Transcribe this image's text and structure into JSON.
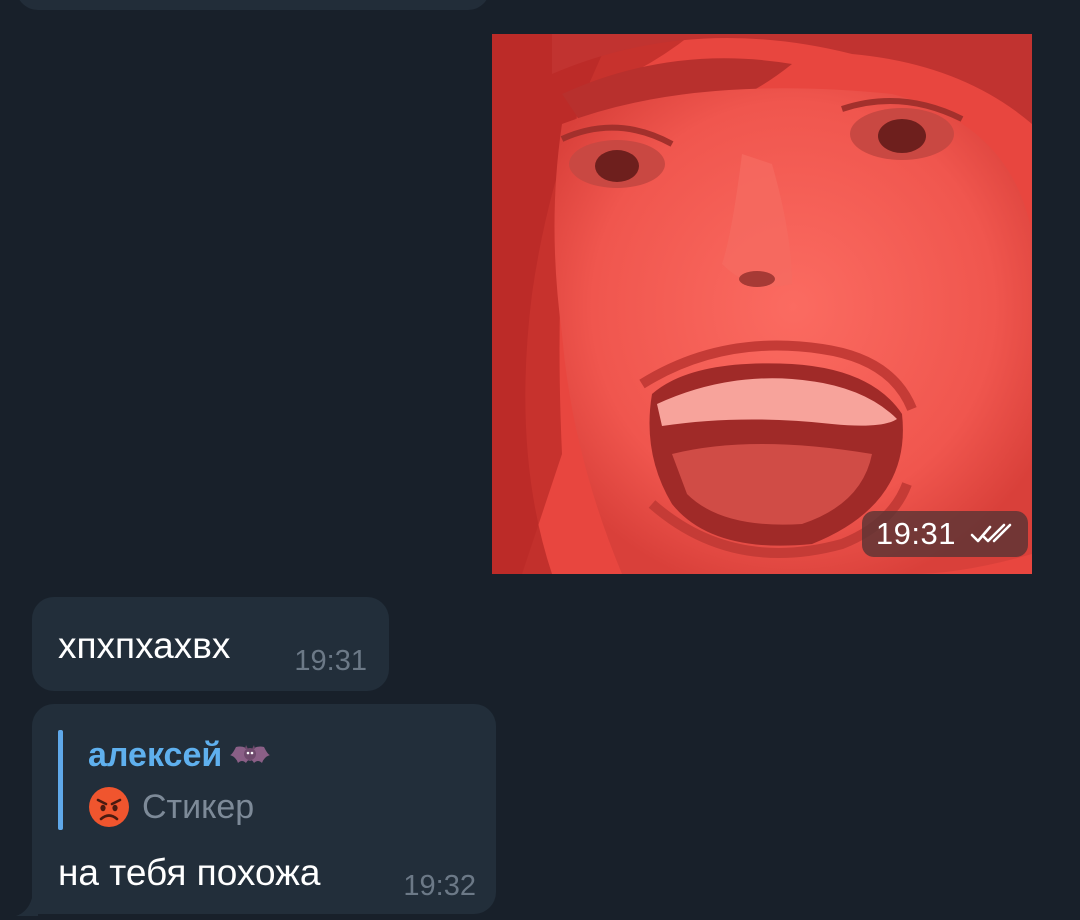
{
  "messages": [
    {
      "type": "sticker",
      "direction": "outgoing",
      "time": "19:31",
      "status_icon": "double-check-icon"
    },
    {
      "type": "text",
      "direction": "incoming",
      "text": "хпхпхахвх",
      "time": "19:31"
    },
    {
      "type": "reply",
      "direction": "incoming",
      "reply": {
        "author": "алексей",
        "author_icon": "bat-emoji-icon",
        "preview_icon": "angry-face-emoji-icon",
        "preview_text": "Стикер"
      },
      "text": "на тебя похожа",
      "time": "19:32"
    }
  ],
  "colors": {
    "background": "#18202a",
    "bubble_incoming": "#222e3a",
    "reply_accent": "#5fa8e9",
    "time_text": "#6c7987"
  }
}
